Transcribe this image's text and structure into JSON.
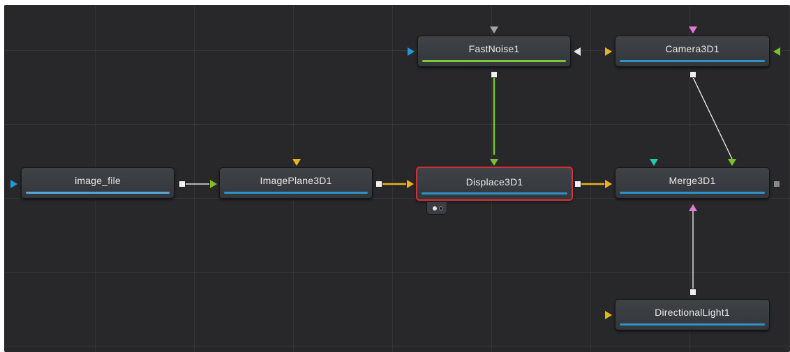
{
  "flow": {
    "nodes": {
      "image_file": {
        "label": "image_file",
        "bar_color": "#5aa6d9"
      },
      "imageplane": {
        "label": "ImagePlane3D1",
        "bar_color": "#2e93c8"
      },
      "displace": {
        "label": "Displace3D1",
        "bar_color": "#2e93c8",
        "selected": true
      },
      "merge": {
        "label": "Merge3D1",
        "bar_color": "#2e93c8"
      },
      "fastnoise": {
        "label": "FastNoise1",
        "bar_color": "#7cc63b"
      },
      "camera": {
        "label": "Camera3D1",
        "bar_color": "#2e93c8"
      },
      "light": {
        "label": "DirectionalLight1",
        "bar_color": "#2e93c8"
      }
    },
    "colors": {
      "canvas": "#28282b",
      "wire_yellow": "#e8b21b",
      "wire_green": "#79c22b",
      "wire_white": "#e6e6e6",
      "selection": "#c8363a",
      "input_blue": "#1f9ad6",
      "input_yellow": "#e8b21b",
      "input_green": "#79c22b",
      "input_pink": "#e37ad8",
      "input_teal": "#26c6b4",
      "input_grey": "#a4a4a4"
    }
  }
}
